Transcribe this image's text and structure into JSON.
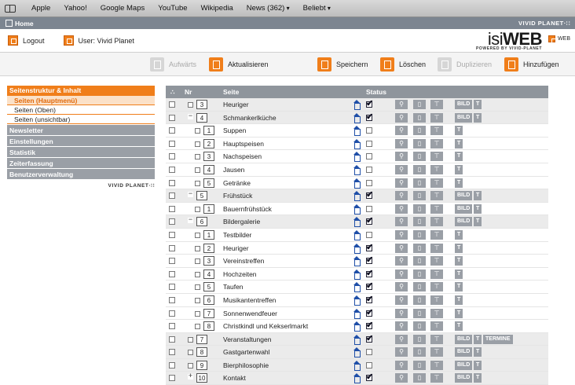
{
  "bookmarks": [
    {
      "label": "Apple",
      "dropdown": false
    },
    {
      "label": "Yahoo!",
      "dropdown": false
    },
    {
      "label": "Google Maps",
      "dropdown": false
    },
    {
      "label": "YouTube",
      "dropdown": false
    },
    {
      "label": "Wikipedia",
      "dropdown": false
    },
    {
      "label": "News (362)",
      "dropdown": true
    },
    {
      "label": "Beliebt",
      "dropdown": true
    }
  ],
  "appbar": {
    "home": "Home",
    "brand": "VIVID PLANET·∷"
  },
  "userbar": {
    "logout": "Logout",
    "user": "User: Vivid Planet",
    "logo_isi": "isi",
    "logo_web": "WEB",
    "logo_sub": "POWERED BY VIVID-PLANET",
    "web_tag": "WEB"
  },
  "toolbar": {
    "up": "Aufwärts",
    "refresh": "Aktualisieren",
    "save": "Speichern",
    "delete": "Löschen",
    "duplicate": "Duplizieren",
    "add": "Hinzufügen"
  },
  "sidebar": {
    "header": "Seitenstruktur & Inhalt",
    "subitems": [
      {
        "label": "Seiten (Hauptmenü)",
        "active": true
      },
      {
        "label": "Seiten (Oben)",
        "active": false
      },
      {
        "label": "Seiten (unsichtbar)",
        "active": false
      }
    ],
    "sections": [
      "Newsletter",
      "Einstellungen",
      "Statistik",
      "Zeiterfassung",
      "Benutzerverwaltung"
    ],
    "brand": "VIVID PLANET·∷"
  },
  "table": {
    "columns": {
      "sel": "∴",
      "nr": "Nr",
      "page": "Seite",
      "status": "Status"
    },
    "bild": "BILD",
    "t": "T",
    "rows": [
      {
        "nr": "3",
        "name": "Heuriger",
        "level": 0,
        "toggle": "",
        "checked": true,
        "bild": true,
        "extra": ""
      },
      {
        "nr": "4",
        "name": "Schmankerlküche",
        "level": 0,
        "toggle": "−",
        "checked": true,
        "bild": true,
        "extra": ""
      },
      {
        "nr": "1",
        "name": "Suppen",
        "level": 1,
        "toggle": "",
        "checked": false,
        "bild": false,
        "extra": ""
      },
      {
        "nr": "2",
        "name": "Hauptspeisen",
        "level": 1,
        "toggle": "",
        "checked": false,
        "bild": false,
        "extra": ""
      },
      {
        "nr": "3",
        "name": "Nachspeisen",
        "level": 1,
        "toggle": "",
        "checked": false,
        "bild": false,
        "extra": ""
      },
      {
        "nr": "4",
        "name": "Jausen",
        "level": 1,
        "toggle": "",
        "checked": false,
        "bild": false,
        "extra": ""
      },
      {
        "nr": "5",
        "name": "Getränke",
        "level": 1,
        "toggle": "",
        "checked": false,
        "bild": false,
        "extra": ""
      },
      {
        "nr": "5",
        "name": "Frühstück",
        "level": 0,
        "toggle": "−",
        "checked": true,
        "bild": true,
        "extra": ""
      },
      {
        "nr": "1",
        "name": "Bauernfrühstück",
        "level": 1,
        "toggle": "",
        "checked": false,
        "bild": true,
        "extra": ""
      },
      {
        "nr": "6",
        "name": "Bildergalerie",
        "level": 0,
        "toggle": "−",
        "checked": true,
        "bild": true,
        "extra": ""
      },
      {
        "nr": "1",
        "name": "Testbilder",
        "level": 1,
        "toggle": "",
        "checked": false,
        "bild": false,
        "extra": ""
      },
      {
        "nr": "2",
        "name": "Heuriger",
        "level": 1,
        "toggle": "",
        "checked": true,
        "bild": false,
        "extra": ""
      },
      {
        "nr": "3",
        "name": "Vereinstreffen",
        "level": 1,
        "toggle": "",
        "checked": true,
        "bild": false,
        "extra": ""
      },
      {
        "nr": "4",
        "name": "Hochzeiten",
        "level": 1,
        "toggle": "",
        "checked": true,
        "bild": false,
        "extra": ""
      },
      {
        "nr": "5",
        "name": "Taufen",
        "level": 1,
        "toggle": "",
        "checked": true,
        "bild": false,
        "extra": ""
      },
      {
        "nr": "6",
        "name": "Musikantentreffen",
        "level": 1,
        "toggle": "",
        "checked": true,
        "bild": false,
        "extra": ""
      },
      {
        "nr": "7",
        "name": "Sonnenwendfeuer",
        "level": 1,
        "toggle": "",
        "checked": true,
        "bild": false,
        "extra": ""
      },
      {
        "nr": "8",
        "name": "Christkindl und Kekserlmarkt",
        "level": 1,
        "toggle": "",
        "checked": true,
        "bild": false,
        "extra": ""
      },
      {
        "nr": "7",
        "name": "Veranstaltungen",
        "level": 0,
        "toggle": "",
        "checked": true,
        "bild": true,
        "extra": "TERMINE"
      },
      {
        "nr": "8",
        "name": "Gastgartenwahl",
        "level": 0,
        "toggle": "",
        "checked": false,
        "bild": true,
        "extra": ""
      },
      {
        "nr": "9",
        "name": "Bierphilosophie",
        "level": 0,
        "toggle": "",
        "checked": false,
        "bild": true,
        "extra": ""
      },
      {
        "nr": "10",
        "name": "Kontakt",
        "level": 0,
        "toggle": "+",
        "checked": true,
        "bild": true,
        "extra": ""
      }
    ]
  }
}
